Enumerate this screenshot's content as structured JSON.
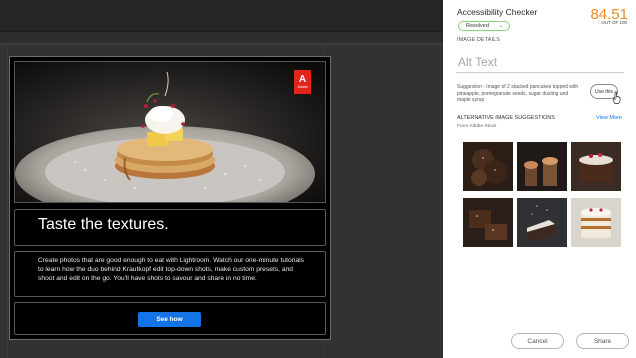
{
  "email": {
    "headline": "Taste the textures.",
    "body": "Create photos that are good enough to eat with Lightroom. Watch our one-minute tutorials to learn how the duo behind Krautkopf edit top-down shots, make custom presets, and shoot and edit on the go. You'll have shots to savour and share in no time.",
    "cta_label": "See how",
    "logo_mark": "A",
    "logo_word": "Adobe"
  },
  "panel": {
    "title": "Accessibility Checker",
    "score": "84.51",
    "score_caption": "OUT OF 100",
    "status": "Resolved",
    "image_details_label": "IMAGE DETAILS",
    "alt_placeholder": "Alt Text",
    "suggestion": "Suggestion : Image of 2 stacked pancakes topped with pineapple, pomegranate seeds, sugar dusting and maple syrup",
    "use_this_label": "Use this",
    "alt_suggestions_title": "ALTERNATIVE IMAGE SUGGESTIONS",
    "alt_suggestions_source": "From Adobe Stock",
    "view_more_label": "View More",
    "cancel_label": "Cancel",
    "share_label": "Share"
  },
  "colors": {
    "score": "#f08a24",
    "cta": "#1473e6",
    "link": "#1473e6",
    "status_border": "#8ad07f",
    "badge": "#e1251b"
  },
  "icons": [
    "chevron-down-icon",
    "pointer-hand-icon",
    "adobe-logo"
  ]
}
